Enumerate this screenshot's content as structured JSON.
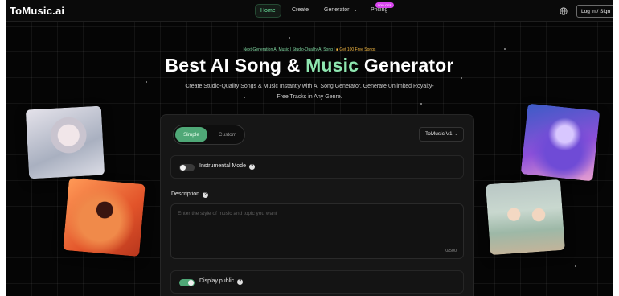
{
  "header": {
    "logo": "ToMusic.ai",
    "nav": {
      "home": "Home",
      "create": "Create",
      "generator": "Generator",
      "pricing": "Pricing",
      "pricing_badge": "50% OFF"
    },
    "login_label": "Log in / Sign"
  },
  "hero": {
    "tagline": "Next-Generation AI Music | Studio-Quality AI Song |",
    "tagline_gift": "Get 100 Free Songs",
    "title_part1": "Best AI Song &",
    "title_accent": "Music",
    "title_part2": "Generator",
    "subtitle": "Create Studio-Quality Songs & Music Instantly with AI Song Generator. Generate Unlimited Royalty-Free Tracks in Any Genre."
  },
  "form": {
    "mode_simple": "Simple",
    "mode_custom": "Custom",
    "model_selected": "ToMusic V1",
    "instrumental_label": "Instrumental Mode",
    "instrumental_on": false,
    "description_label": "Description",
    "description_placeholder": "Enter the style of music and topic you want",
    "char_count": "0/500",
    "display_public_label": "Display public",
    "display_public_on": true
  },
  "colors": {
    "accent_green": "#4fa877",
    "title_accent": "#8ee6b0",
    "background": "#050505"
  }
}
